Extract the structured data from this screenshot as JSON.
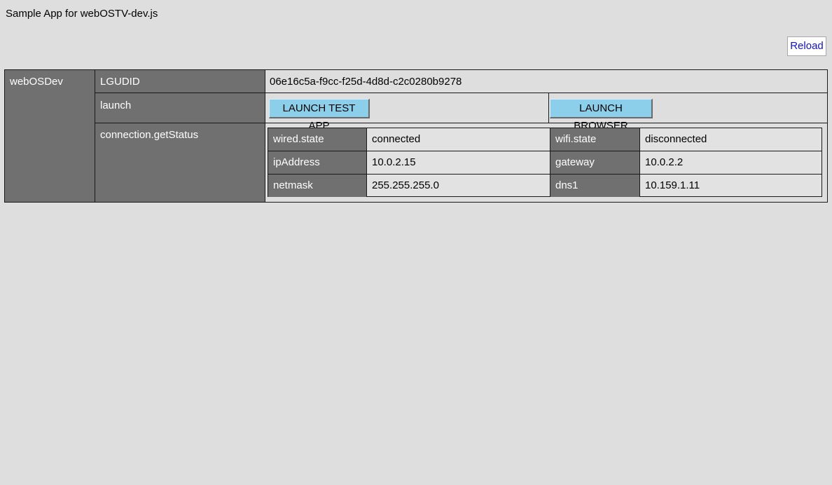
{
  "app": {
    "title": "Sample App for webOSTV-dev.js",
    "reload_label": "Reload"
  },
  "table": {
    "section_label": "webOSDev",
    "rows": {
      "lgudid": {
        "key": "LGUDID",
        "value": "06e16c5a-f9cc-f25d-4d8d-c2c0280b9278"
      },
      "launch": {
        "key": "launch",
        "test_app_label": "LAUNCH TEST APP",
        "browser_label": "LAUNCH BROWSER"
      },
      "connection": {
        "key": "connection.getStatus",
        "status": [
          {
            "key1": "wired.state",
            "value1": "connected",
            "key2": "wifi.state",
            "value2": "disconnected"
          },
          {
            "key1": "ipAddress",
            "value1": "10.0.2.15",
            "key2": "gateway",
            "value2": "10.0.2.2"
          },
          {
            "key1": "netmask",
            "value1": "255.255.255.0",
            "key2": "dns1",
            "value2": "10.159.1.11"
          }
        ]
      }
    }
  },
  "colors": {
    "background": "#dedede",
    "header_cell": "#707070",
    "button": "#8ccfea",
    "link_text": "#1010e6"
  }
}
